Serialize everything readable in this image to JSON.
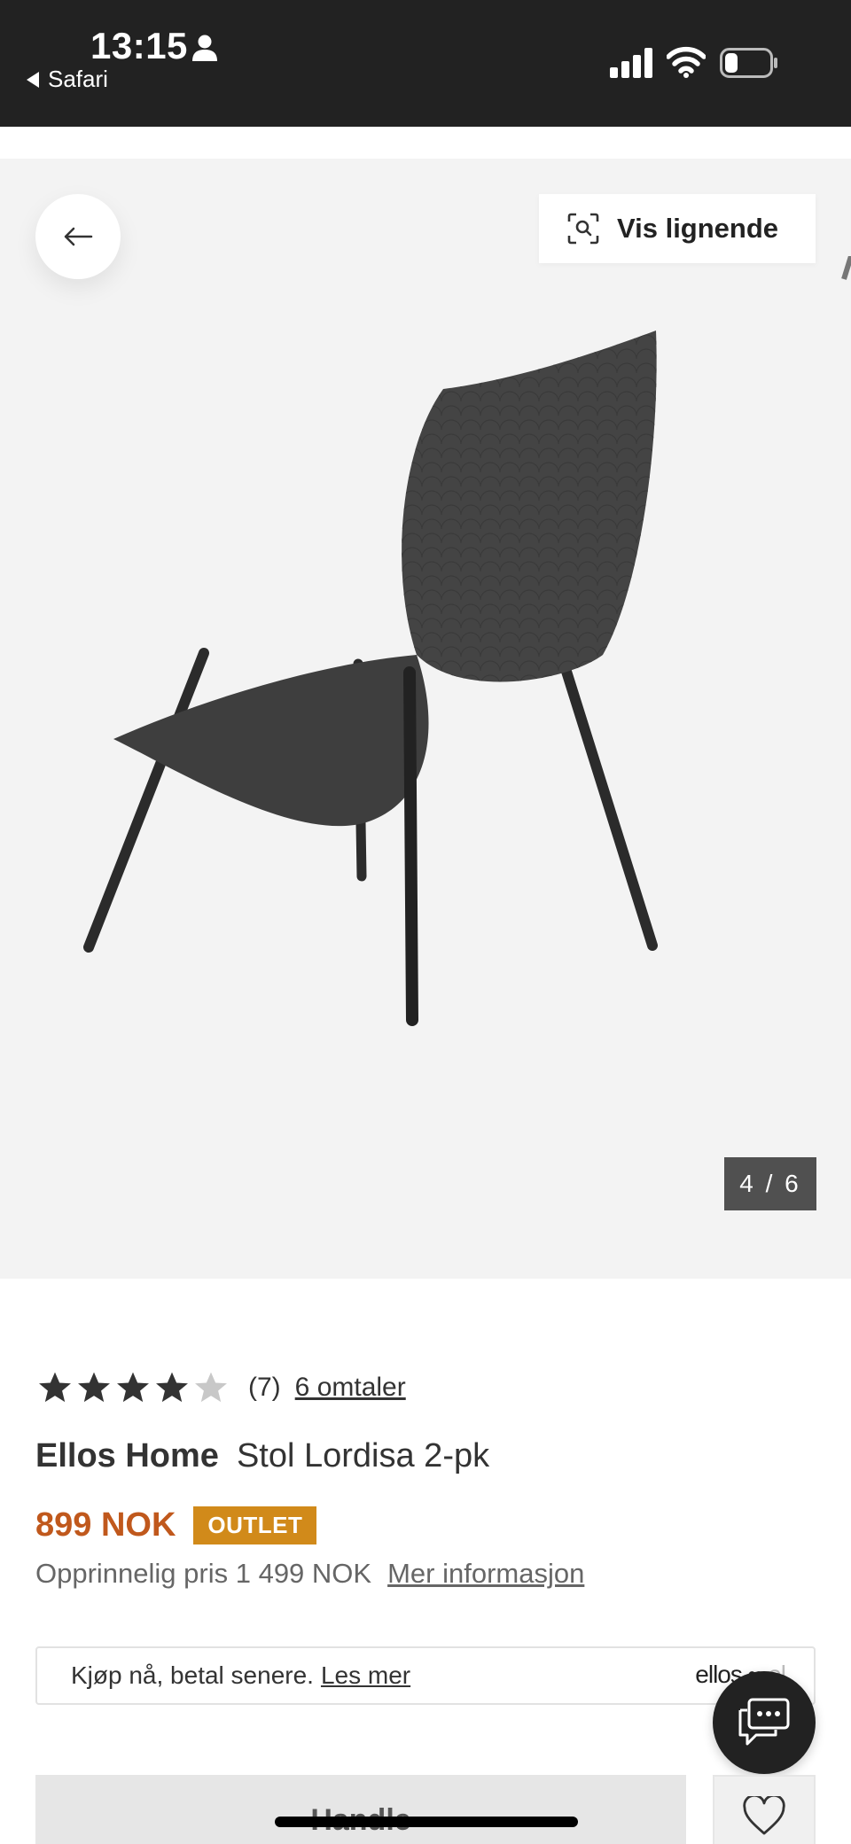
{
  "status_bar": {
    "time": "13:15",
    "back_app": "Safari",
    "icons": [
      "person-icon",
      "signal-icon",
      "wifi-icon",
      "battery-icon"
    ]
  },
  "gallery": {
    "similar_label": "Vis lignende",
    "counter": "4 / 6",
    "icons": [
      "arrow-left-icon",
      "visual-search-icon"
    ]
  },
  "product": {
    "rating": {
      "value": 4,
      "max": 5,
      "count_label": "(7)",
      "reviews_label": "6 omtaler"
    },
    "brand": "Ellos Home",
    "name": "Stol Lordisa 2-pk",
    "price": "899 NOK",
    "badge": "OUTLET",
    "original_price": "Opprinnelig pris 1 499 NOK",
    "more_info": "Mer informasjon"
  },
  "klarna": {
    "text": "Kjøp nå, betal senere.",
    "link": "Les mer",
    "logo": "ellos"
  },
  "actions": {
    "buy_label": "Handle",
    "icons": [
      "chat-icon",
      "heart-icon"
    ]
  },
  "colors": {
    "status_bar": "#222222",
    "price": "#c0581c",
    "outlet_badge": "#d18a1a",
    "counter_bg": "#505050",
    "gallery_bg": "#f3f3f3"
  }
}
